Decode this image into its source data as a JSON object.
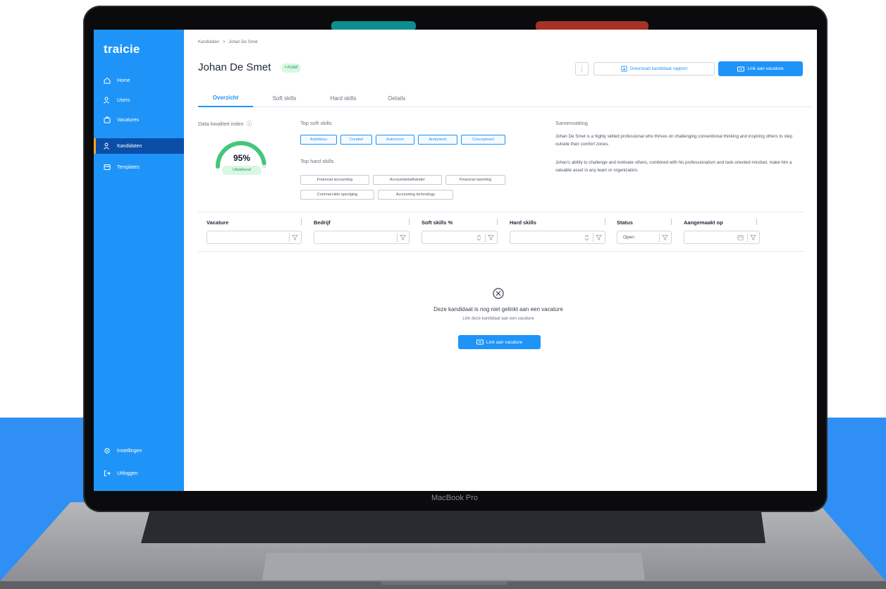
{
  "app": {
    "brand": "traicie"
  },
  "sidebar": {
    "items": [
      {
        "label": "Home",
        "icon": "home-icon"
      },
      {
        "label": "Users",
        "icon": "users-icon"
      },
      {
        "label": "Vacatures",
        "icon": "vacatures-icon"
      },
      {
        "label": "Kandidaten",
        "icon": "kandidaten-icon",
        "active": true
      },
      {
        "label": "Templates",
        "icon": "templates-icon"
      }
    ],
    "bottom": [
      {
        "label": "Instellingen",
        "icon": "gear-icon"
      },
      {
        "label": "Uitloggen",
        "icon": "logout-icon"
      }
    ]
  },
  "breadcrumb": {
    "parent": "Kandidaten",
    "separator": ">",
    "current": "Johan De Smet"
  },
  "candidate": {
    "name": "Johan De Smet",
    "status": "• Actief"
  },
  "header": {
    "download_label": "Download kandidaat rapport",
    "link_label": "Link aan vacature",
    "more_label": "⋮"
  },
  "tabs": [
    "Overzicht",
    "Soft skills",
    "Hard skills",
    "Details"
  ],
  "quality": {
    "label": "Data kwaliteit index",
    "info": "ⓘ",
    "value": "95%",
    "level": 0.95,
    "badge": "Uitstekend"
  },
  "soft_skills": {
    "title": "Top soft skills",
    "items": [
      "Ambitieus",
      "Creatief",
      "Autonoom",
      "Analytisch",
      "Conceptueel"
    ]
  },
  "hard_skills": {
    "title": "Top hard skills",
    "items": [
      "Financial accounting",
      "Accountdetailhander",
      "Financial reporting",
      "Commerciële opvolging",
      "Accounting technology"
    ]
  },
  "summary": {
    "title": "Samenvatting",
    "paragraph1": "Johan De Smet is a highly skilled professional who thrives on challenging conventional thinking and inspiring others to step outside their comfort zones.",
    "paragraph2": "Johan's ability to challenge and motivate others, combined with his professionalism and task-oriented mindset, make him a valuable asset in any team or organization."
  },
  "table": {
    "columns": [
      "Vacature",
      "Bedrijf",
      "Soft skills %",
      "Hard skills",
      "Status",
      "Aangemaakt op"
    ],
    "status_filter_value": "Open"
  },
  "empty_state": {
    "title": "Deze kandidaat is nog niet gelinkt aan een vacature",
    "subtitle": "Link deze kandidaat aan een vacature",
    "button": "Link aan vacature"
  },
  "device": {
    "label": "MacBook Pro"
  },
  "colors": {
    "accent": "#1f94f8",
    "sidebar": "#1f94f8",
    "active_nav": "#0a4ea8",
    "success": "#1b9b53",
    "band": "#2f8ff5"
  }
}
